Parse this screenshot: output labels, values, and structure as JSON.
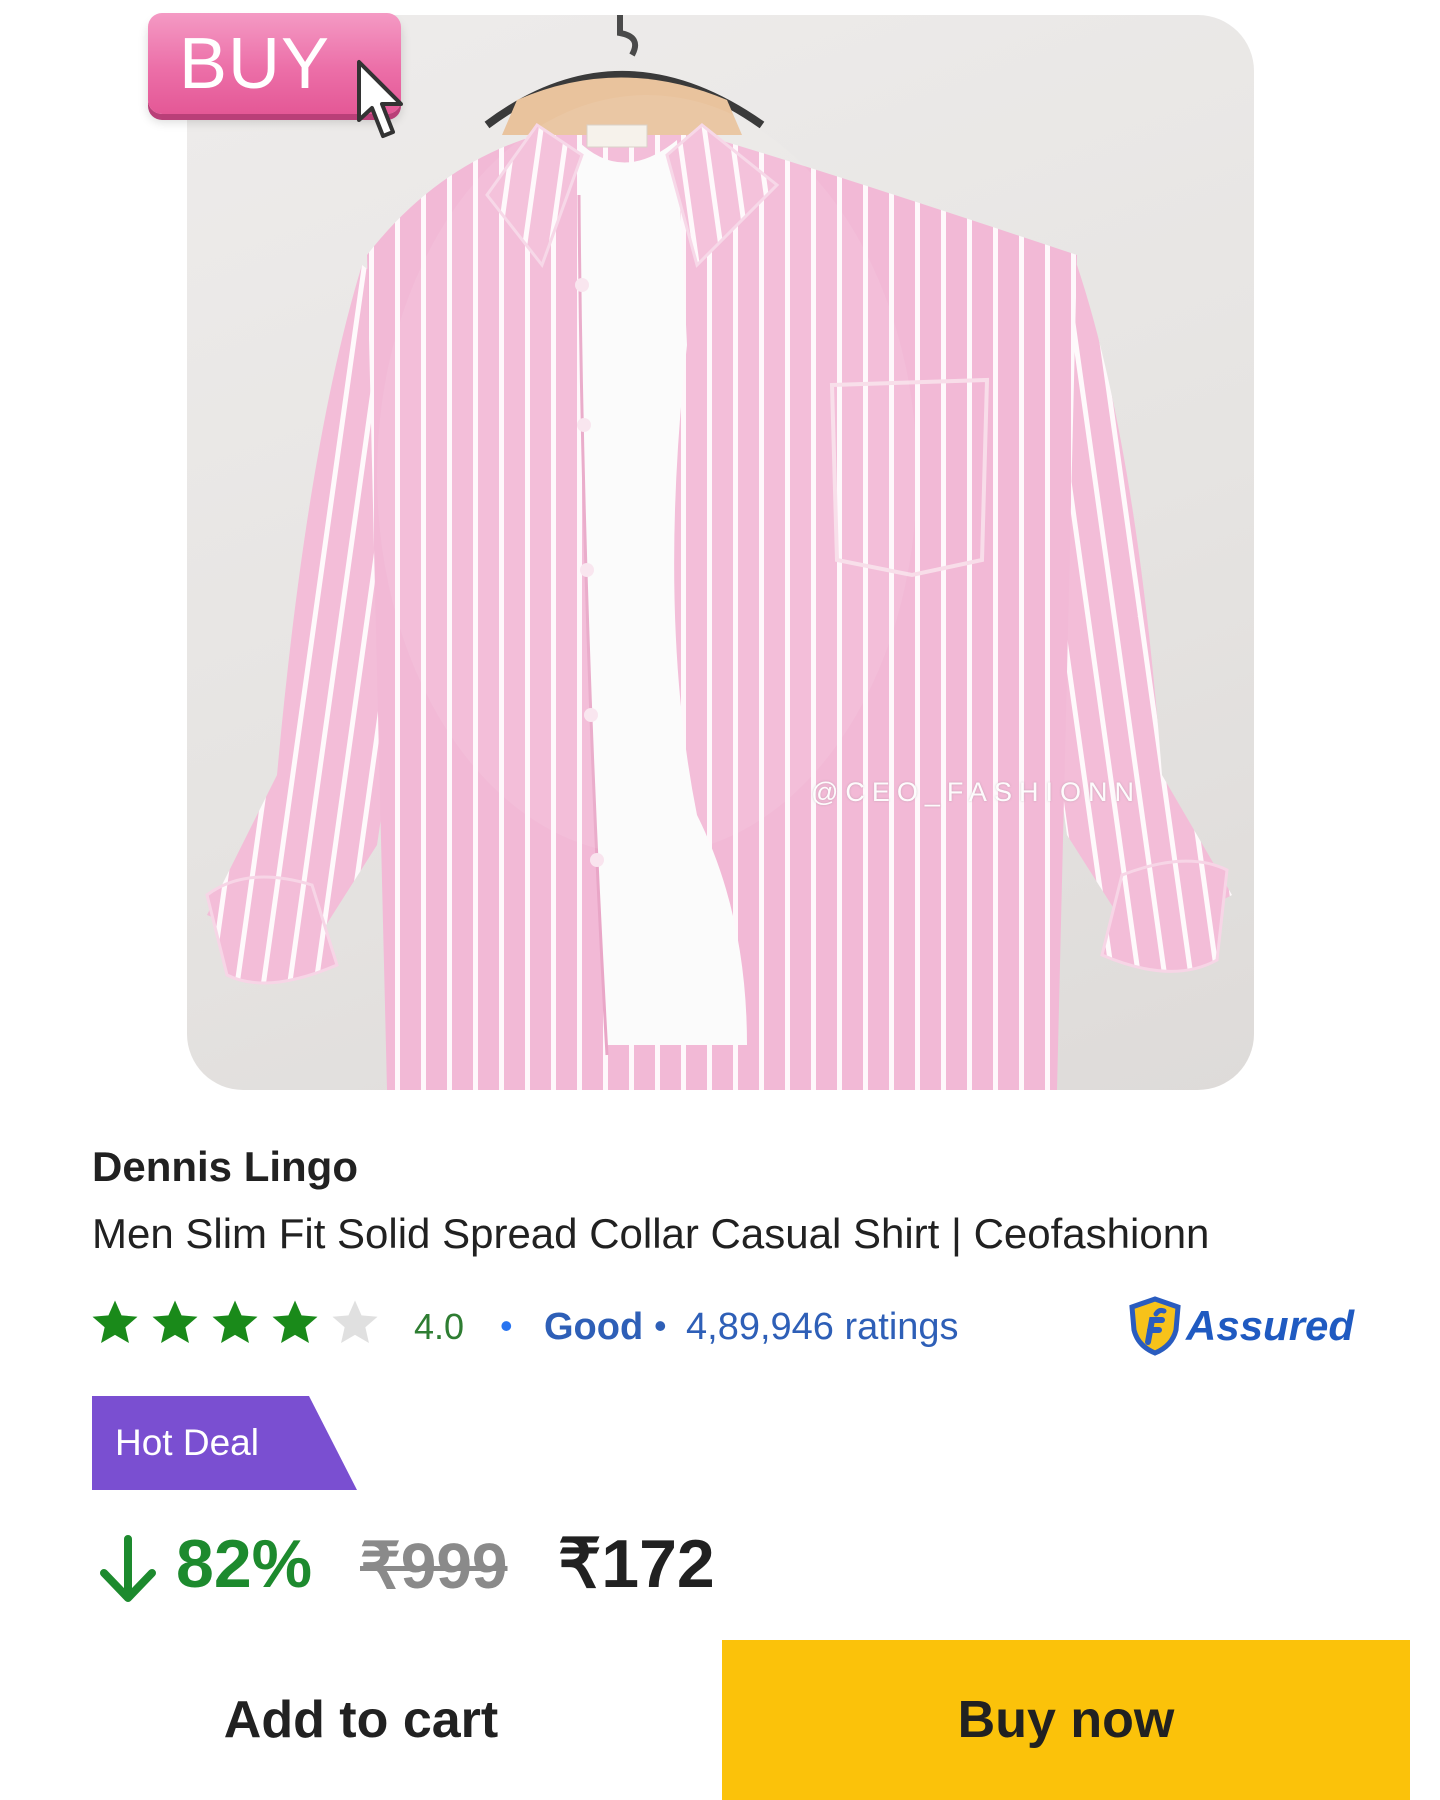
{
  "image": {
    "sticker_label": "BUY",
    "watermark": "@CEO_FASHIONN",
    "colors": {
      "shirt": "#f2b9d6",
      "stripe": "#ffffff",
      "sticker": "#ec6fa8"
    }
  },
  "product": {
    "brand": "Dennis Lingo",
    "title": "Men Slim Fit Solid Spread Collar Casual Shirt | Ceofashionn"
  },
  "rating": {
    "stars_filled": 4,
    "stars_total": 5,
    "value": "4.0",
    "separator": "•",
    "label": "Good",
    "count_text": "4,89,946 ratings",
    "assured_label": "Assured",
    "colors": {
      "star_filled": "#1a8a1a",
      "star_empty": "#e0e0e0"
    }
  },
  "deal": {
    "badge": "Hot Deal",
    "badge_color": "#7a4fd1",
    "discount": "82%",
    "mrp": "₹999",
    "price": "₹172"
  },
  "actions": {
    "add_to_cart": "Add to cart",
    "buy_now": "Buy now",
    "buy_now_color": "#fbc20a"
  }
}
